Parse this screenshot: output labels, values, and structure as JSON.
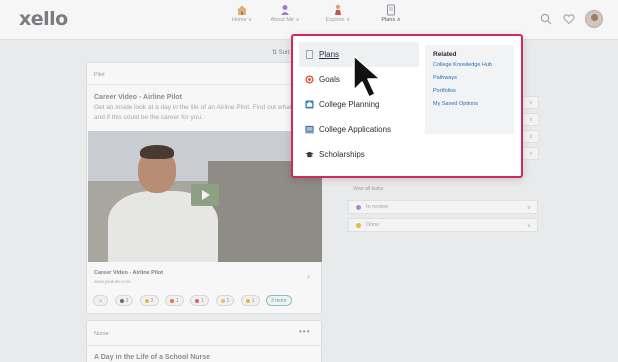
{
  "app": {
    "logo": "xello"
  },
  "nav": {
    "items": [
      {
        "label": "Home",
        "chevron": "∨"
      },
      {
        "label": "About Me",
        "chevron": "∨"
      },
      {
        "label": "Explore",
        "chevron": "∨"
      },
      {
        "label": "Plans",
        "chevron": "∧"
      }
    ],
    "accent": "#b23f8a"
  },
  "page": {
    "sort_label": "Sort"
  },
  "feed": {
    "card1": {
      "tag": "Pilot",
      "title": "Career Video - Airline Pilot",
      "description": "Get an inside look at a day in the life of an Airline Pilot. Find out what it takes, and if this could be the career for you.",
      "video_caption": "Career Video - Airline Pilot",
      "video_url": "www.youtube.com",
      "reactions": [
        {
          "icon": "smile-icon",
          "count": ""
        },
        {
          "icon": "glasses-icon",
          "count": "3"
        },
        {
          "icon": "thumbs-up-icon",
          "count": "2"
        },
        {
          "icon": "fire-icon",
          "count": "1"
        },
        {
          "icon": "heart-eyes-icon",
          "count": "1"
        },
        {
          "icon": "clap-icon",
          "count": "1"
        },
        {
          "icon": "star-struck-icon",
          "count": "1"
        }
      ],
      "more_label": "3 more"
    },
    "card2": {
      "tag": "Nurse",
      "menu": "•••",
      "title": "A Day in the Life of a School Nurse"
    }
  },
  "side": {
    "view_all": "View all tasks",
    "status_rows": [
      {
        "label": "In review",
        "color": "#a98bd6"
      },
      {
        "label": "Done",
        "color": "#e0b850"
      }
    ]
  },
  "dropdown": {
    "border_color": "#cf2a5c",
    "items": [
      {
        "label": "Plans",
        "icon": "document-icon",
        "active": true
      },
      {
        "label": "Goals",
        "icon": "target-icon",
        "active": false
      },
      {
        "label": "College Planning",
        "icon": "college-icon",
        "active": false
      },
      {
        "label": "College Applications",
        "icon": "laptop-icon",
        "active": false
      },
      {
        "label": "Scholarships",
        "icon": "graduation-cap-icon",
        "active": false
      }
    ],
    "related": {
      "title": "Related",
      "links": [
        "College Knowledge Hub",
        "Pathways",
        "Portfolios",
        "My Saved Options"
      ]
    }
  }
}
